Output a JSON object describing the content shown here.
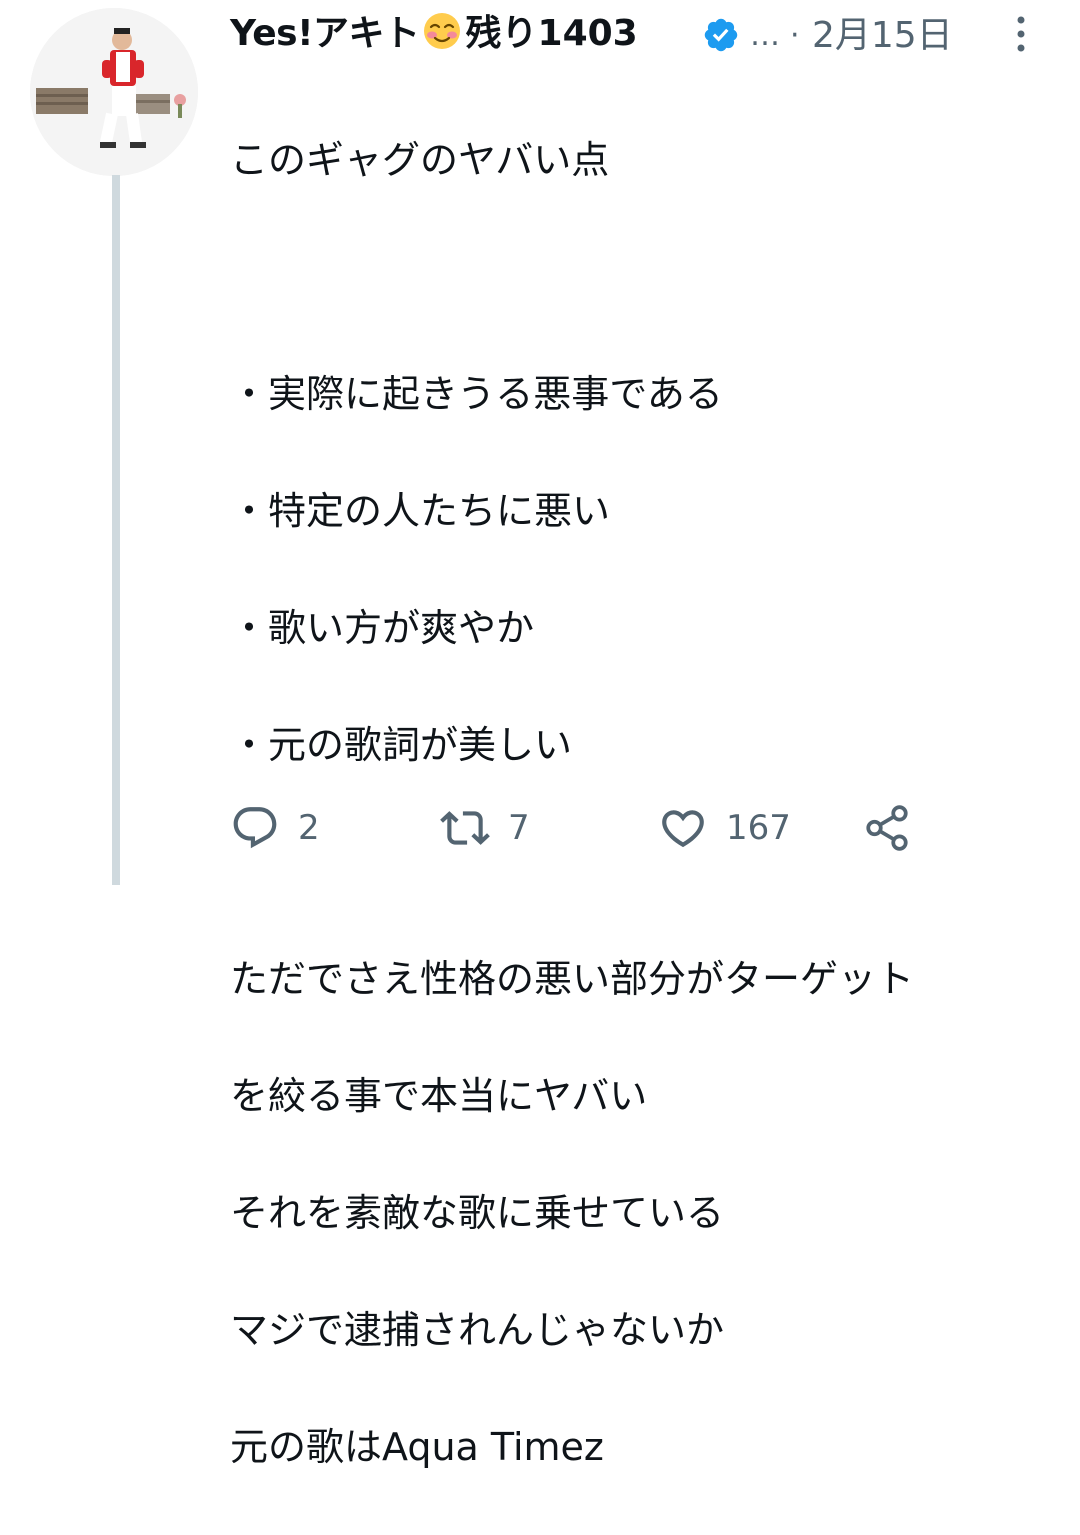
{
  "author": {
    "display_name": "Yes!アキト",
    "display_name_suffix": "残り1403",
    "emoji": "smiling-face-with-smiling-eyes",
    "verified": true,
    "ellipsis": "…",
    "separator": "·",
    "date": "2月15日",
    "avatar": "avatar-photo-person-red-shirt"
  },
  "tweet": {
    "lines": [
      "このギャグのヤバい点",
      "",
      "・実際に起きうる悪事である",
      "・特定の人たちに悪い",
      "・歌い方が爽やか",
      "・元の歌詞が美しい",
      "",
      "ただでさえ性格の悪い部分がターゲット",
      "を絞る事で本当にヤバい",
      "それを素敵な歌に乗せている",
      "マジで逮捕されんじゃないか",
      "元の歌はAqua Timez"
    ]
  },
  "actions": {
    "reply": {
      "icon": "reply-icon",
      "count": "2"
    },
    "retweet": {
      "icon": "retweet-icon",
      "count": "7"
    },
    "like": {
      "icon": "heart-icon",
      "count": "167"
    },
    "share": {
      "icon": "share-icon"
    }
  },
  "colors": {
    "text": "#0f1419",
    "secondary": "#536471",
    "verified": "#1d9bf0",
    "thread_line": "#cfd9de"
  }
}
